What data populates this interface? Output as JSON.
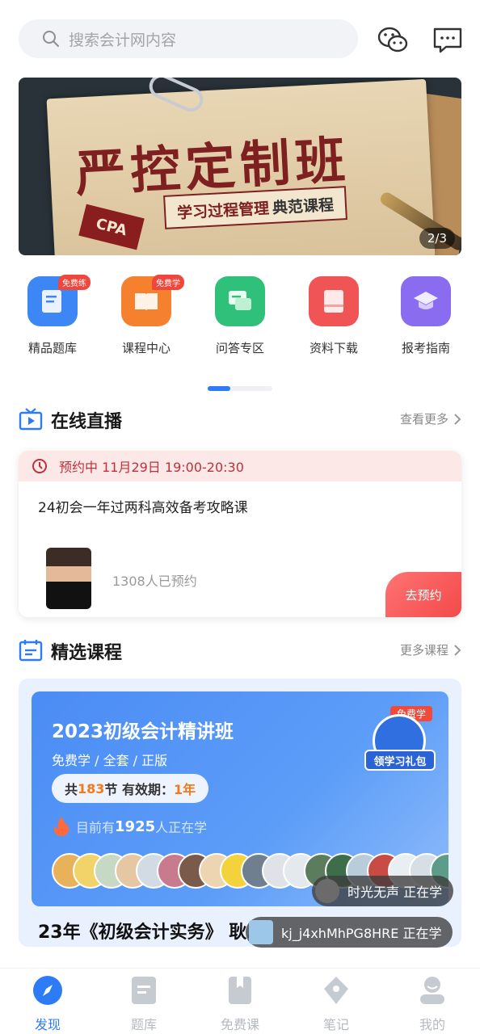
{
  "search": {
    "placeholder": "搜索会计网内容"
  },
  "header": {
    "icons": [
      "wechat-icon",
      "message-icon"
    ]
  },
  "banner": {
    "title": "严控定制班",
    "subtitle_main": "学习过程管理",
    "subtitle_bold": "典范课程",
    "tag": "CPA",
    "pager": "2/3"
  },
  "quick_menu": [
    {
      "label": "精品题库",
      "badge": "免费练",
      "color": "#3d86f5",
      "icon": "document-icon"
    },
    {
      "label": "课程中心",
      "badge": "免费学",
      "color": "#f5812f",
      "icon": "book-icon"
    },
    {
      "label": "问答专区",
      "badge": "",
      "color": "#2fc07a",
      "icon": "chat-icon"
    },
    {
      "label": "资料下载",
      "badge": "",
      "color": "#f05454",
      "icon": "file-icon"
    },
    {
      "label": "报考指南",
      "badge": "",
      "color": "#8a6cf0",
      "icon": "graduation-cap-icon"
    }
  ],
  "live_section": {
    "title": "在线直播",
    "more": "查看更多",
    "card": {
      "schedule": "预约中 11月29日 19:00-20:30",
      "title": "24初会一年过两科高效备考攻略课",
      "count": "1308人已预约",
      "button": "去预约"
    }
  },
  "course_section": {
    "title": "精选课程",
    "more": "更多课程",
    "card": {
      "title": "2023初级会计精讲班",
      "tags": "免费学 / 全套 / 正版",
      "pill_prefix": "共",
      "pill_lessons": "183",
      "pill_mid": "节 有效期：",
      "pill_validity": "1年",
      "learners_prefix": "目前有",
      "learners_count": "1925",
      "learners_suffix": "人正在学",
      "gift_tag": "免费学",
      "gift_label": "领学习礼包",
      "next_title": "23年《初级会计实务》 耿..."
    }
  },
  "toasts": [
    {
      "text": "时光无声 正在学"
    },
    {
      "text": "kj_j4xhMhPG8HRE 正在学"
    }
  ],
  "bottom_nav": [
    {
      "label": "发现",
      "icon": "compass-icon",
      "active": true
    },
    {
      "label": "题库",
      "icon": "question-bank-icon",
      "active": false
    },
    {
      "label": "免费课",
      "icon": "bookmark-icon",
      "active": false
    },
    {
      "label": "笔记",
      "icon": "pen-nib-icon",
      "active": false
    },
    {
      "label": "我的",
      "icon": "user-icon",
      "active": false
    }
  ],
  "colors": {
    "accent": "#2d7cf6",
    "live_red": "#c0303a",
    "orange": "#f27a1a"
  }
}
